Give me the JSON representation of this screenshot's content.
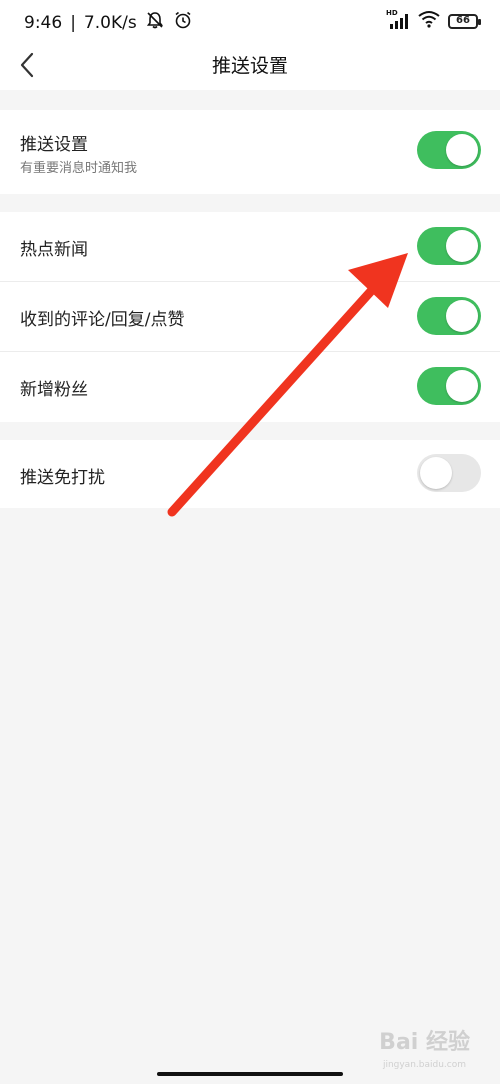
{
  "status_bar": {
    "time": "9:46",
    "network_speed": "7.0K/s",
    "separator": "|",
    "battery_level": "66",
    "hd_badge": "HD",
    "icons": [
      "mute-bell-icon",
      "alarm-clock-icon",
      "signal-icon",
      "wifi-icon",
      "battery-icon"
    ]
  },
  "header": {
    "title": "推送设置",
    "back_icon": "chevron-left-icon"
  },
  "sections": {
    "push": {
      "label": "推送设置",
      "sublabel": "有重要消息时通知我",
      "enabled": true
    },
    "hot_news": {
      "label": "热点新闻",
      "enabled": true
    },
    "comments": {
      "label": "收到的评论/回复/点赞",
      "enabled": true
    },
    "new_fans": {
      "label": "新增粉丝",
      "enabled": true
    },
    "dnd": {
      "label": "推送免打扰",
      "enabled": false
    }
  },
  "colors": {
    "toggle_on": "#3fbe5e",
    "toggle_off": "#e7e7e7",
    "annotation_arrow": "#f0341f",
    "background": "#f5f5f5"
  },
  "watermark": {
    "text": "Bai 经验",
    "subtext": "jingyan.baidu.com"
  }
}
